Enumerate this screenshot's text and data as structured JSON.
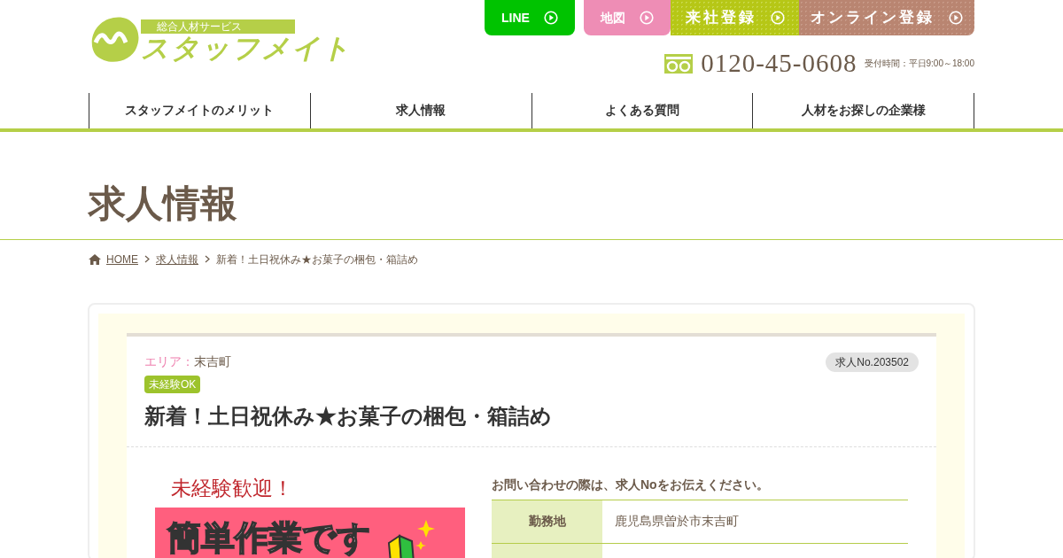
{
  "logo": {
    "tagline": "総合人材サービス",
    "name": "スタッフメイト"
  },
  "header_buttons": [
    {
      "label": "LINE",
      "kind": "line"
    },
    {
      "label": "地図",
      "kind": "map"
    },
    {
      "label": "来社登録",
      "kind": "visit"
    },
    {
      "label": "オンライン登録",
      "kind": "online"
    }
  ],
  "phone": {
    "number": "0120-45-0608",
    "hours": "受付時間：平日9:00～18:00"
  },
  "nav": [
    {
      "label": "スタッフメイトのメリット"
    },
    {
      "label": "求人情報"
    },
    {
      "label": "よくある質問"
    },
    {
      "label": "人材をお探しの企業様"
    }
  ],
  "page_title": "求人情報",
  "breadcrumb": [
    {
      "label": "HOME",
      "link": true
    },
    {
      "label": "求人情報",
      "link": true
    },
    {
      "label": "新着！土日祝休み★お菓子の梱包・箱詰め",
      "link": false
    }
  ],
  "job": {
    "area_label": "エリア：",
    "area": "末吉町",
    "job_no": "求人No.203502",
    "tags": [
      "未経験OK"
    ],
    "title": "新着！土日祝休み★お菓子の梱包・箱詰め",
    "banner": {
      "headline": "未経験歓迎！",
      "caption": "簡単作業です"
    },
    "notice": "お問い合わせの際は、求人Noをお伝えください。",
    "details": [
      {
        "label": "勤務地",
        "value": "鹿児島県曽於市末吉町"
      }
    ]
  }
}
